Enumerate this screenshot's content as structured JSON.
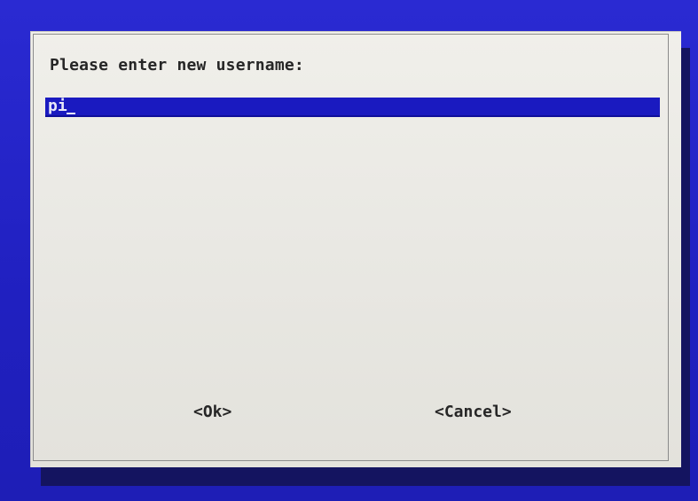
{
  "dialog": {
    "prompt": "Please enter new username:",
    "input": {
      "value": "pi"
    },
    "buttons": {
      "ok_label": "<Ok>",
      "cancel_label": "<Cancel>"
    }
  },
  "colors": {
    "screen_background": "#2323c8",
    "dialog_background": "#eceae5",
    "input_background": "#1a1ac0",
    "text": "#262626"
  }
}
